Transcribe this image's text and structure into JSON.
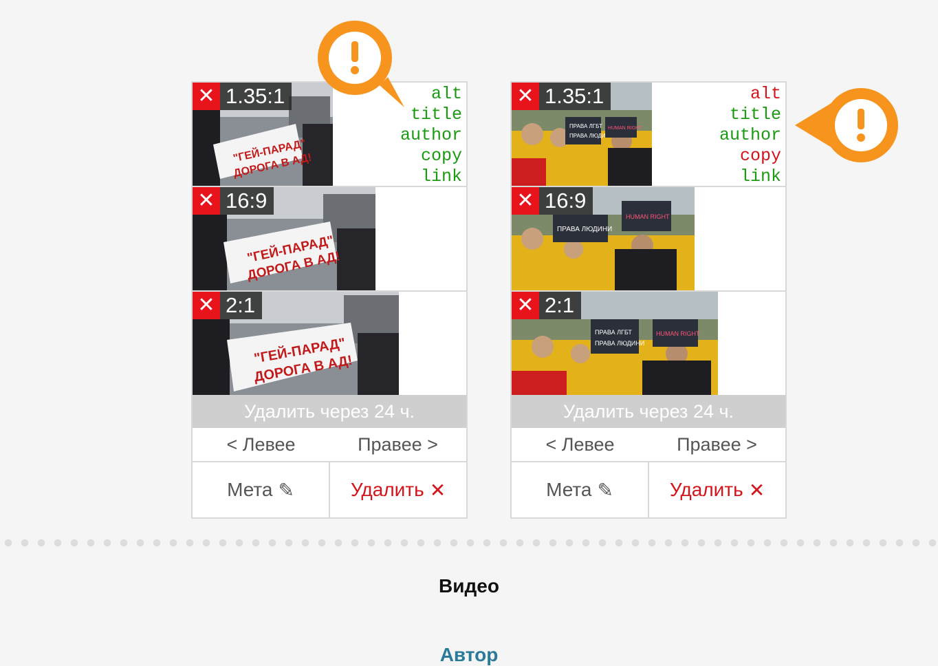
{
  "cards": [
    {
      "crops": [
        {
          "ratio": "1.35:1",
          "remove_icon": "close-icon"
        },
        {
          "ratio": "16:9",
          "remove_icon": "close-icon"
        },
        {
          "ratio": "2:1",
          "remove_icon": "close-icon"
        }
      ],
      "meta_fields": [
        {
          "label": "alt",
          "status": "ok"
        },
        {
          "label": "title",
          "status": "ok"
        },
        {
          "label": "author",
          "status": "ok"
        },
        {
          "label": "copy",
          "status": "ok"
        },
        {
          "label": "link",
          "status": "ok"
        }
      ],
      "expire_text": "Удалить через 24 ч.",
      "move_left": "< Левее",
      "move_right": "Правее >",
      "meta_button": "Мета",
      "meta_button_icon": "pencil-icon",
      "delete_button": "Удалить",
      "delete_button_icon": "close-icon",
      "warning_icon": "exclamation-icon"
    },
    {
      "crops": [
        {
          "ratio": "1.35:1",
          "remove_icon": "close-icon"
        },
        {
          "ratio": "16:9",
          "remove_icon": "close-icon"
        },
        {
          "ratio": "2:1",
          "remove_icon": "close-icon"
        }
      ],
      "meta_fields": [
        {
          "label": "alt",
          "status": "missing"
        },
        {
          "label": "title",
          "status": "ok"
        },
        {
          "label": "author",
          "status": "ok"
        },
        {
          "label": "copy",
          "status": "missing"
        },
        {
          "label": "link",
          "status": "ok"
        }
      ],
      "expire_text": "Удалить через 24 ч.",
      "move_left": "< Левее",
      "move_right": "Правее >",
      "meta_button": "Мета",
      "meta_button_icon": "pencil-icon",
      "delete_button": "Удалить",
      "delete_button_icon": "close-icon",
      "warning_icon": "exclamation-icon"
    }
  ],
  "colors": {
    "ok": "#1a9b12",
    "missing": "#d4141b",
    "warning": "#f7941d",
    "delete": "#d4141b"
  },
  "section_title": "Видео",
  "author_label": "Автор"
}
